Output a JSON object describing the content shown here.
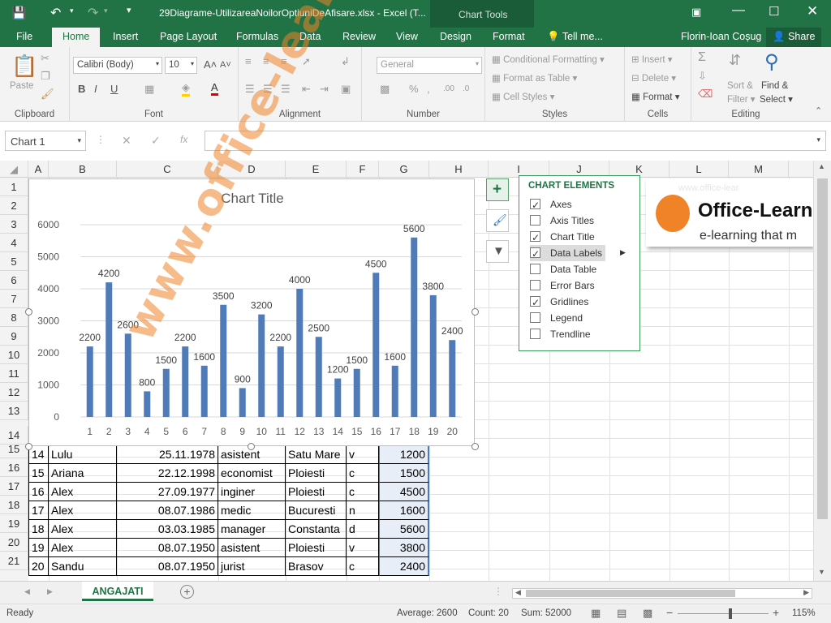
{
  "titlebar": {
    "filename": "29Diagrame-UtilizareaNoilorOptiuniDeAfisare.xlsx - Excel (T...",
    "chart_tools": "Chart Tools"
  },
  "tabs": [
    "File",
    "Home",
    "Insert",
    "Page Layout",
    "Formulas",
    "Data",
    "Review",
    "View",
    "Design",
    "Format"
  ],
  "tell_me": "Tell me...",
  "user": "Florin-Ioan Coșug",
  "share": "Share",
  "ribbon": {
    "clipboard": {
      "paste": "Paste",
      "label": "Clipboard"
    },
    "font": {
      "name": "Calibri (Body)",
      "size": "10",
      "label": "Font"
    },
    "alignment": {
      "label": "Alignment"
    },
    "number": {
      "format": "General",
      "label": "Number"
    },
    "styles": {
      "conditional": "Conditional Formatting",
      "format_table": "Format as Table",
      "cell_styles": "Cell Styles",
      "label": "Styles"
    },
    "cells": {
      "insert": "Insert",
      "delete": "Delete",
      "format": "Format",
      "label": "Cells"
    },
    "editing": {
      "sort": "Sort &",
      "filter": "Filter",
      "find": "Find &",
      "select": "Select",
      "label": "Editing"
    }
  },
  "namebox": "Chart 1",
  "fx": "fx",
  "columns": [
    "A",
    "B",
    "C",
    "D",
    "E",
    "F",
    "G",
    "H",
    "I",
    "J",
    "K",
    "L",
    "M"
  ],
  "rows": [
    "1",
    "2",
    "3",
    "4",
    "5",
    "6",
    "7",
    "8",
    "9",
    "10",
    "11",
    "12",
    "13",
    "14",
    "15",
    "16",
    "17",
    "18",
    "19",
    "20",
    "21"
  ],
  "table_rows": [
    {
      "a": "14",
      "b": "Lulu",
      "c": "25.11.1978",
      "d": "asistent",
      "e": "Satu Mare",
      "f": "v",
      "g": "1200"
    },
    {
      "a": "15",
      "b": "Ariana",
      "c": "22.12.1998",
      "d": "economist",
      "e": "Ploiesti",
      "f": "c",
      "g": "1500"
    },
    {
      "a": "16",
      "b": "Alex",
      "c": "27.09.1977",
      "d": "inginer",
      "e": "Ploiesti",
      "f": "c",
      "g": "4500"
    },
    {
      "a": "17",
      "b": "Alex",
      "c": "08.07.1986",
      "d": "medic",
      "e": "Bucuresti",
      "f": "n",
      "g": "1600"
    },
    {
      "a": "18",
      "b": "Alex",
      "c": "03.03.1985",
      "d": "manager",
      "e": "Constanta",
      "f": "d",
      "g": "5600"
    },
    {
      "a": "19",
      "b": "Alex",
      "c": "08.07.1950",
      "d": "asistent",
      "e": "Ploiesti",
      "f": "v",
      "g": "3800"
    },
    {
      "a": "20",
      "b": "Sandu",
      "c": "08.07.1950",
      "d": "jurist",
      "e": "Brasov",
      "f": "c",
      "g": "2400"
    }
  ],
  "chart_elements": {
    "title": "CHART ELEMENTS",
    "items": [
      {
        "label": "Axes",
        "checked": true
      },
      {
        "label": "Axis Titles",
        "checked": false
      },
      {
        "label": "Chart Title",
        "checked": true
      },
      {
        "label": "Data Labels",
        "checked": true
      },
      {
        "label": "Data Table",
        "checked": false
      },
      {
        "label": "Error Bars",
        "checked": false
      },
      {
        "label": "Gridlines",
        "checked": true
      },
      {
        "label": "Legend",
        "checked": false
      },
      {
        "label": "Trendline",
        "checked": false
      }
    ]
  },
  "logo": {
    "brand": "Office-Learn",
    "tagline": "e-learning that m",
    "faint": "www.office-lear"
  },
  "watermark": "www.office-learning.ro",
  "sheet_tab": "ANGAJATI",
  "status": {
    "ready": "Ready",
    "average": "Average: 2600",
    "count": "Count: 20",
    "sum": "Sum: 52000",
    "zoom": "115%"
  },
  "colors": {
    "excel_green": "#217346",
    "bar": "#4f7cb8",
    "accent_orange": "#f08228"
  },
  "chart_data": {
    "type": "bar",
    "title": "Chart Title",
    "categories": [
      "1",
      "2",
      "3",
      "4",
      "5",
      "6",
      "7",
      "8",
      "9",
      "10",
      "11",
      "12",
      "13",
      "14",
      "15",
      "16",
      "17",
      "18",
      "19",
      "20"
    ],
    "values": [
      2200,
      4200,
      2600,
      800,
      1500,
      2200,
      1600,
      3500,
      900,
      3200,
      2200,
      4000,
      2500,
      1200,
      1500,
      4500,
      1600,
      5600,
      3800,
      2400
    ],
    "yticks": [
      "0",
      "1000",
      "2000",
      "3000",
      "4000",
      "5000",
      "6000"
    ],
    "ylim": [
      0,
      6000
    ],
    "gridlines": true,
    "data_labels": true,
    "legend": false
  }
}
